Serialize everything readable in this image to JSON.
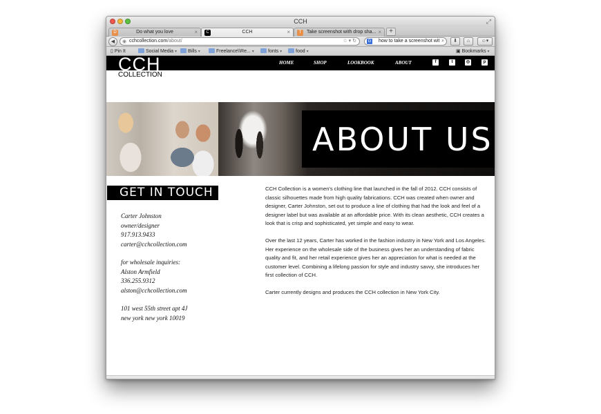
{
  "window": {
    "title": "CCH"
  },
  "tabs": [
    {
      "label": "Do what you love",
      "icon": "tab-favicon-orange"
    },
    {
      "label": "CCH",
      "icon": "tab-favicon-black"
    },
    {
      "label": "Take screenshot with drop sha...",
      "icon": "tab-favicon-orange"
    }
  ],
  "newtab_label": "+",
  "navbar": {
    "back_label": "◀",
    "url_domain": "cchcollection.com",
    "url_path": "/about/",
    "search_text": "how to take a screenshot wit",
    "search_engine": "G"
  },
  "bookmarks": [
    {
      "label": "Pin It",
      "folder": false
    },
    {
      "label": "Social Media",
      "folder": true
    },
    {
      "label": "Bills",
      "folder": true
    },
    {
      "label": "Freelance\\\\Re...",
      "folder": true
    },
    {
      "label": "fonts",
      "folder": true
    },
    {
      "label": "food",
      "folder": true
    }
  ],
  "bookmarks_right": "Bookmarks",
  "site": {
    "logo_main": "CCH",
    "logo_sub": "COLLECTION",
    "nav": [
      "HOME",
      "SHOP",
      "LOOKBOOK",
      "ABOUT"
    ],
    "social": [
      {
        "name": "facebook-icon",
        "glyph": "f"
      },
      {
        "name": "twitter-icon",
        "glyph": "t"
      },
      {
        "name": "instagram-icon",
        "glyph": "◎"
      },
      {
        "name": "pinterest-icon",
        "glyph": "p"
      }
    ],
    "banner_title": "ABOUT US",
    "contact_heading": "GET IN TOUCH",
    "contact": {
      "name": "Carter Johnston",
      "role": "owner/designer",
      "phone": "917.913.9433",
      "email": "carter@cchcollection.com",
      "wholesale_label": "for wholesale inquiries:",
      "wholesale_name": "Alston Armfield",
      "wholesale_phone": "336.255.9312",
      "wholesale_email": "alston@cchcollection.com",
      "address_line1": "101 west 55th street apt 4J",
      "address_line2": "new york new york 10019"
    },
    "about_paragraphs": [
      "CCH Collection is a women's clothing line that launched in the fall of 2012. CCH consists of classic silhouettes made from high quality fabrications. CCH was created when owner and designer, Carter Johnston, set out to produce a line of clothing that had the look and feel of a designer label but was available at an affordable price. With its clean aesthetic, CCH creates a look that is crisp and sophisticated, yet simple and easy to wear.",
      "Over the last 12 years, Carter has worked in the fashion industry in New York and Los Angeles. Her experience on the wholesale side of the business gives her an understanding of fabric quality and fit, and her retail experience gives her an appreciation for what is needed at the customer level. Combining a lifelong passion for style and industry savvy, she introduces her first collection of CCH.",
      "Carter currently designs and produces the CCH collection in New York City."
    ]
  }
}
